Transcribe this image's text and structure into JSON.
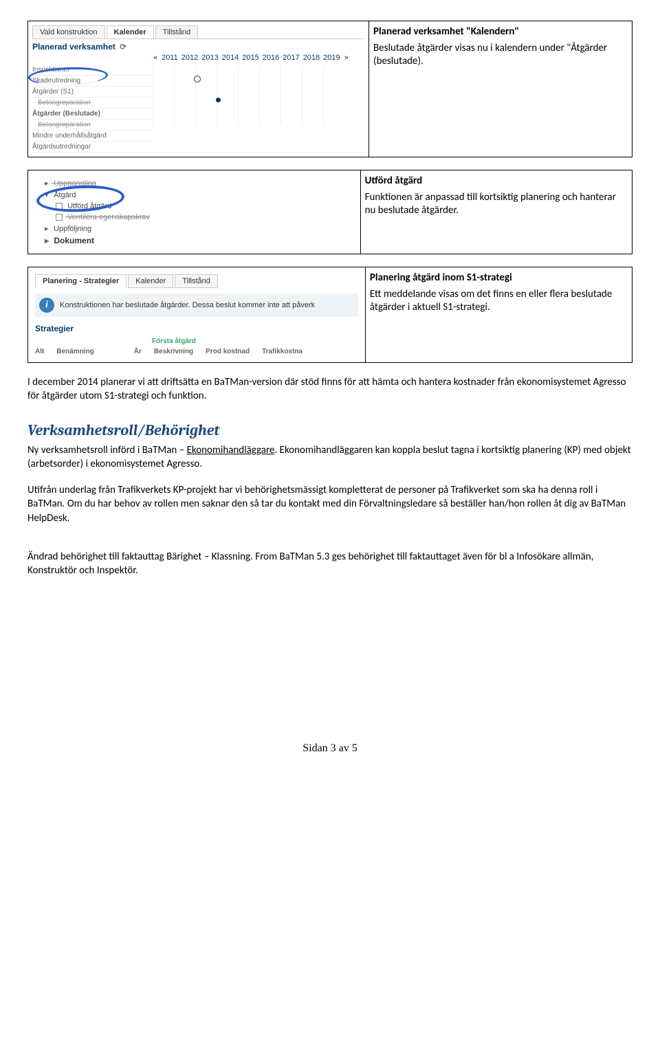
{
  "row1": {
    "ui": {
      "tabs": [
        "Vald konstruktion",
        "Kalender",
        "Tillstånd"
      ],
      "active_tab": 1,
      "heading": "Planerad verksamhet",
      "heading_icon": "⟳",
      "nav_prev": "«",
      "nav_next": "»",
      "years": [
        "2011",
        "2012",
        "2013",
        "2014",
        "2015",
        "2016",
        "2017",
        "2018",
        "2019"
      ],
      "rows": [
        "Inspektioner",
        "Skadeutredning",
        "Åtgärder (S1)",
        "Betongreparation",
        "Åtgärder (Beslutade)",
        "Betongreparation",
        "Mindre underhållsåtgärd",
        "Åtgärdsutredningar"
      ]
    },
    "title": "Planerad verksamhet \"Kalendern\"",
    "body": "Beslutade åtgärder visas nu i kalendern under \"Åtgärder (beslutade)."
  },
  "row2": {
    "ui": {
      "items": [
        {
          "label": "Uppgangling",
          "type": "cut"
        },
        {
          "label": "Åtgärd",
          "type": "expanded"
        },
        {
          "label": "Utförd åtgärd",
          "type": "leaf"
        },
        {
          "label": "Ventilera egenskapskrav",
          "type": "cut-leaf"
        },
        {
          "label": "Uppföljning",
          "type": "collapsed"
        },
        {
          "label": "Dokument",
          "type": "bold"
        }
      ]
    },
    "title": "Utförd åtgärd",
    "body": "Funktionen är anpassad till kortsiktig planering och hanterar nu beslutade åtgärder."
  },
  "row3": {
    "ui": {
      "tabs": [
        "Planering - Strategier",
        "Kalender",
        "Tillstånd"
      ],
      "info_text": "Konstruktionen har beslutade åtgärder. Dessa beslut kommer inte att påverk",
      "heading": "Strategier",
      "subheading": "Första åtgärd",
      "cols": [
        "Alt",
        "Benämning",
        "År",
        "Beskrivning",
        "Prod kostnad",
        "Trafikkostna"
      ]
    },
    "title": "Planering åtgärd inom S1-strategi",
    "body": "Ett meddelande visas om det finns en eller flera beslutade åtgärder i aktuell S1-strategi."
  },
  "para1": "I december 2014 planerar vi att driftsätta en BaTMan-version där stöd finns för att hämta och hantera kostnader från ekonomisystemet Agresso för åtgärder utom S1-strategi och funktion.",
  "section_heading": "Verksamhetsroll/Behörighet",
  "para2a": "Ny verksamhetsroll införd i  BaTMan – ",
  "para2b": "Ekonomihandläggare",
  "para2c": ". Ekonomihandläggaren kan koppla beslut tagna i kortsiktig planering (KP) med objekt (arbetsorder) i ekonomisystemet Agresso.",
  "para3": "Utifrån underlag från Trafikverkets KP-projekt har vi behörighetsmässigt kompletterat de personer på Trafikverket som ska ha denna roll i BaTMan. Om du har behov av rollen men saknar den så tar du kontakt med din Förvaltningsledare så beställer han/hon rollen åt dig av BaTMan HelpDesk.",
  "para4": "Ändrad behörighet till faktauttag Bärighet – Klassning. From BaTMan 5.3 ges behörighet till faktauttaget även för bl a Infosökare allmän, Konstruktör och Inspektör.",
  "footer": "Sidan 3 av 5"
}
